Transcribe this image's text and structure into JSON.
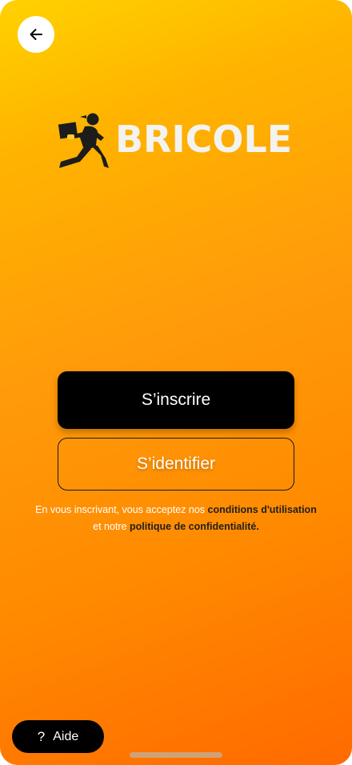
{
  "header": {
    "back_icon": "arrow-left-icon"
  },
  "logo": {
    "brand_name": "BRICOLE",
    "mark_icon": "running-delivery-person-icon"
  },
  "actions": {
    "signup_label": "S’inscrire",
    "login_label": "S’identifier"
  },
  "terms": {
    "prefix": "En vous inscrivant, vous acceptez nos ",
    "conditions_link": "conditions d'utilisation",
    "middle": " et notre ",
    "privacy_link": "politique de confidentialité."
  },
  "help": {
    "icon": "question-mark-icon",
    "icon_glyph": "?",
    "label": "Aide"
  },
  "colors": {
    "gradient_top": "#ffd200",
    "gradient_bottom": "#ff6a00",
    "primary_button": "#000000",
    "brand_text": "#f3f3f0"
  }
}
